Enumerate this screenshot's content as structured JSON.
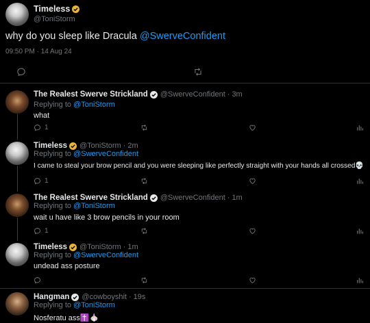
{
  "main_tweet": {
    "display_name": "Timeless",
    "handle": "@ToniStorm",
    "text_prefix": "why do you sleep like Dracula ",
    "text_mention": "@SwerveConfident",
    "timestamp": "09:50 PM · 14 Aug 24"
  },
  "replies": [
    {
      "display_name": "The Realest Swerve Strickland",
      "handle": "@SwerveConfident",
      "time": "3m",
      "replying_label": "Replying to ",
      "replying_to": "@ToniStorm",
      "text": "what",
      "reply_count": "1"
    },
    {
      "display_name": "Timeless",
      "handle": "@ToniStorm",
      "time": "2m",
      "replying_label": "Replying to ",
      "replying_to": "@SwerveConfident",
      "text": "I came to steal your brow pencil and you were sleeping like perfectly straight with your hands all crossed💀",
      "reply_count": "1"
    },
    {
      "display_name": "The Realest Swerve Strickland",
      "handle": "@SwerveConfident",
      "time": "1m",
      "replying_label": "Replying to ",
      "replying_to": "@ToniStorm",
      "text": "wait u have like 3 brow pencils in your room",
      "reply_count": "1"
    },
    {
      "display_name": "Timeless",
      "handle": "@ToniStorm",
      "time": "1m",
      "replying_label": "Replying to ",
      "replying_to": "@SwerveConfident",
      "text": "undead ass posture",
      "reply_count": ""
    },
    {
      "display_name": "Hangman",
      "handle": "@cowboyshit",
      "time": "19s",
      "replying_label": "Replying to ",
      "replying_to": "@ToniStorm",
      "text": "Nosferatu ass✝️🧄",
      "reply_count": ""
    }
  ],
  "colors": {
    "background": "#000000",
    "accent": "#1d9bf0",
    "muted": "#71767b",
    "verified_gold": "#e8b33a"
  },
  "icons": [
    "reply-icon",
    "retweet-icon",
    "like-icon",
    "stats-icon",
    "verified-badge-icon"
  ]
}
